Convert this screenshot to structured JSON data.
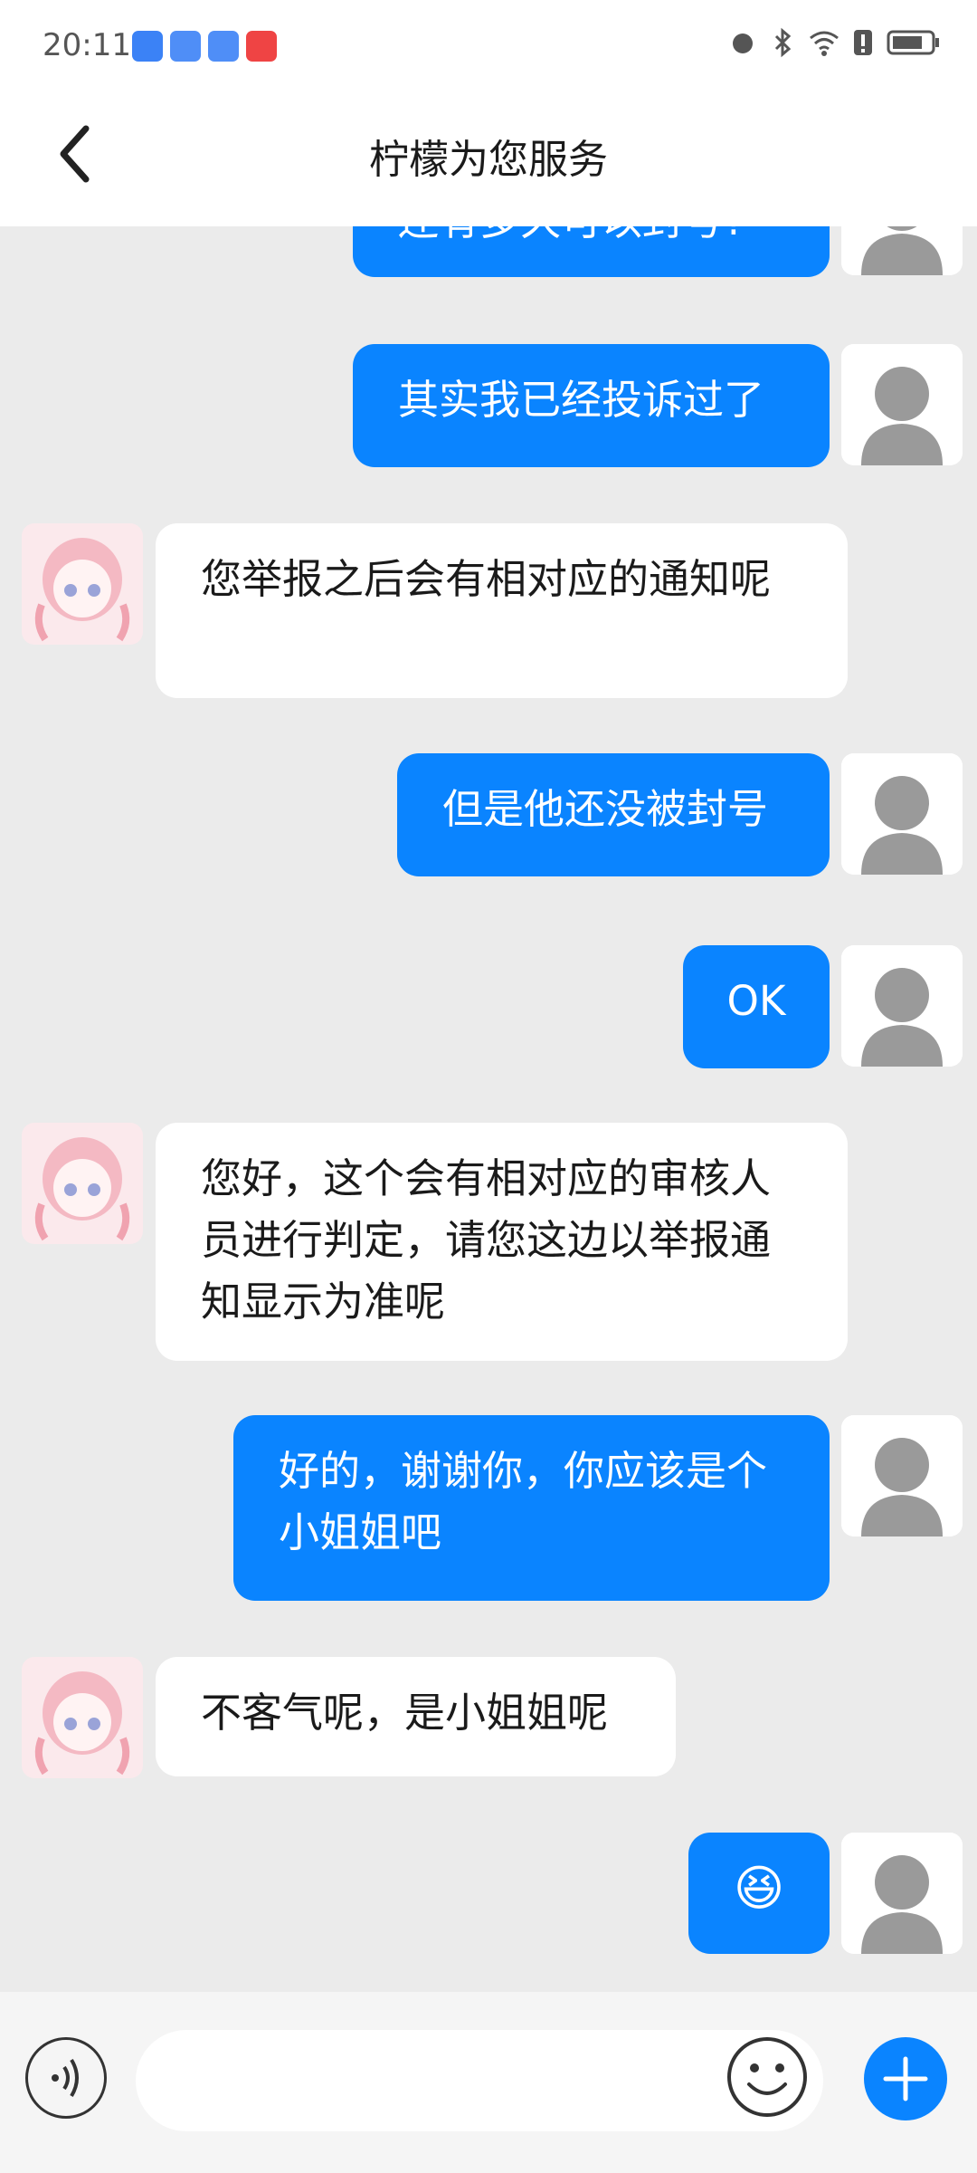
{
  "status_bar": {
    "time": "20:11"
  },
  "header": {
    "title": "柠檬为您服务"
  },
  "messages": [
    {
      "from": "user",
      "text": "还有多久可以封号?"
    },
    {
      "from": "user",
      "text": "其实我已经投诉过了"
    },
    {
      "from": "agent",
      "text": "您举报之后会有相对应的通知呢"
    },
    {
      "from": "user",
      "text": "但是他还没被封号"
    },
    {
      "from": "user",
      "text": "OK"
    },
    {
      "from": "agent",
      "text": "您好，这个会有相对应的审核人员进行判定，请您这边以举报通知显示为准呢"
    },
    {
      "from": "user",
      "text": "好的，谢谢你，你应该是个小姐姐吧"
    },
    {
      "from": "agent",
      "text": "不客气呢，是小姐姐呢"
    },
    {
      "from": "user",
      "text": "😆"
    }
  ],
  "input": {
    "placeholder": ""
  },
  "colors": {
    "accent": "#0a84ff",
    "background": "#ebebeb"
  },
  "icons": {
    "back": "chevron-left-icon",
    "voice": "voice-icon",
    "emoji": "smiley-icon",
    "add": "plus-icon"
  }
}
